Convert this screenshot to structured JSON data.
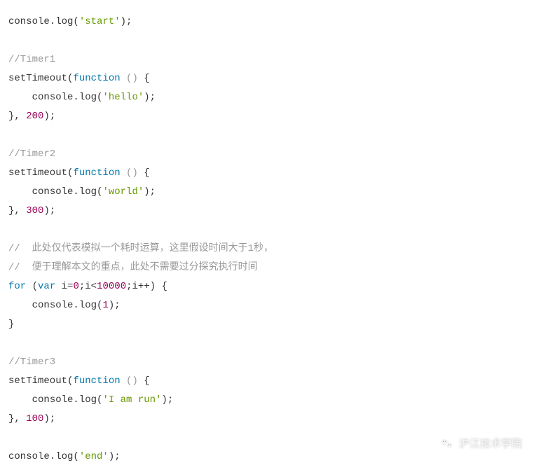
{
  "code": {
    "line1_console": "console",
    "line1_log": ".log(",
    "line1_str": "'start'",
    "line1_end": ");",
    "comment_timer1": "//Timer1",
    "line3_a": "setTimeout(",
    "line3_fn": "function ",
    "line3_paren": "()",
    "line3_brace": " {",
    "line4_indent": "    ",
    "line4_console": "console",
    "line4_log": ".log(",
    "line4_str": "'hello'",
    "line4_end": ");",
    "line5_a": "}, ",
    "line5_num": "200",
    "line5_end": ");",
    "comment_timer2": "//Timer2",
    "line7_a": "setTimeout(",
    "line7_fn": "function ",
    "line7_paren": "()",
    "line7_brace": " {",
    "line8_indent": "    ",
    "line8_console": "console",
    "line8_log": ".log(",
    "line8_str": "'world'",
    "line8_end": ");",
    "line9_a": "}, ",
    "line9_num": "300",
    "line9_end": ");",
    "comment_cn1": "//  此处仅代表模拟一个耗时运算，这里假设时间大于1秒，",
    "comment_cn2": "//  便于理解本文的重点，此处不需要过分探究执行时间",
    "line_for_kw1": "for",
    "line_for_a": " (",
    "line_for_var": "var",
    "line_for_b": " i=",
    "line_for_zero": "0",
    "line_for_c": ";i<",
    "line_for_limit": "10000",
    "line_for_d": ";i++) {",
    "line_for_body_indent": "    ",
    "line_for_body_console": "console",
    "line_for_body_log": ".log(",
    "line_for_body_num": "1",
    "line_for_body_end": ");",
    "line_for_close": "}",
    "comment_timer3": "//Timer3",
    "line13_a": "setTimeout(",
    "line13_fn": "function ",
    "line13_paren": "()",
    "line13_brace": " {",
    "line14_indent": "    ",
    "line14_console": "console",
    "line14_log": ".log(",
    "line14_str": "'I am run'",
    "line14_end": ");",
    "line15_a": "}, ",
    "line15_num": "100",
    "line15_end": ");",
    "line16_console": "console",
    "line16_log": ".log(",
    "line16_str": "'end'",
    "line16_end": ");"
  },
  "watermark": {
    "text": "沪江技术学院"
  }
}
